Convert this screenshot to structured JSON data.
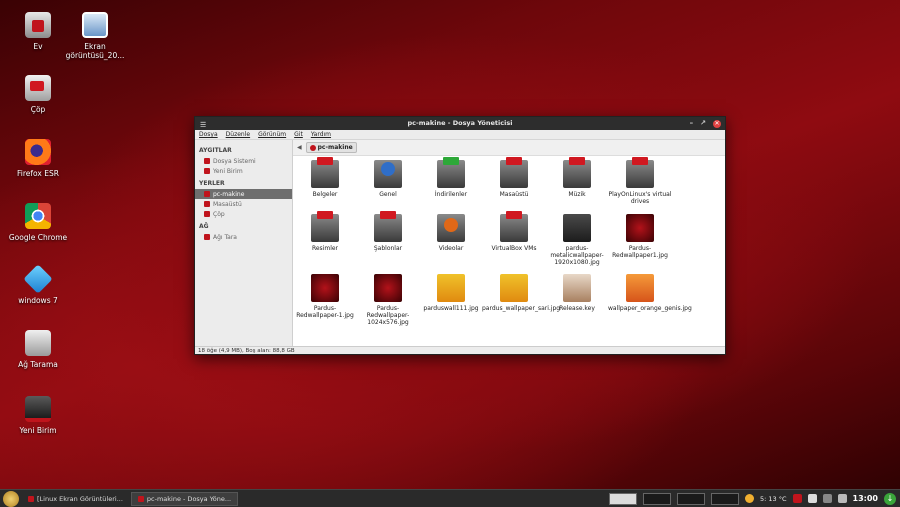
{
  "desktop": {
    "icons": [
      {
        "label": "Ev",
        "icon": "home-icon"
      },
      {
        "label": "Ekran görüntüsü_20...",
        "icon": "image-icon"
      },
      {
        "label": "Çöp",
        "icon": "trash-icon"
      },
      {
        "label": "Firefox ESR",
        "icon": "firefox-icon"
      },
      {
        "label": "Google Chrome",
        "icon": "chrome-icon"
      },
      {
        "label": "windows 7",
        "icon": "virtualbox-icon"
      },
      {
        "label": "Ağ Tarama",
        "icon": "scanner-icon"
      },
      {
        "label": "Yeni Birim",
        "icon": "drive-icon"
      }
    ]
  },
  "window": {
    "title": "pc-makine - Dosya Yöneticisi",
    "menu": [
      "Dosya",
      "Düzenle",
      "Görünüm",
      "Git",
      "Yardım"
    ],
    "sidebar": {
      "devices_header": "AYGITLAR",
      "devices": [
        "Dosya Sistemi",
        "Yeni Birim"
      ],
      "places_header": "YERLER",
      "places": [
        "pc-makine",
        "Masaüstü",
        "Çöp"
      ],
      "network_header": "AĞ",
      "network": [
        "Ağı Tara"
      ]
    },
    "path": "pc-makine",
    "files": [
      "Belgeler",
      "Genel",
      "İndirilenler",
      "Masaüstü",
      "Müzik",
      "PlayOnLinux's virtual drives",
      "Resimler",
      "Şablonlar",
      "Videolar",
      "VirtualBox VMs",
      "pardus-metalicwallpaper-1920x1080.jpg",
      "Pardus-Redwallpaper1.jpg",
      "Pardus-Redwallpaper-1.jpg",
      "Pardus-Redwallpaper-1024x576.jpg",
      "parduswall111.jpg",
      "pardus_wallpaper_sari.jpg",
      "Release.key",
      "wallpaper_orange_genis.jpg"
    ],
    "status": "18 öğe (4,9 MB), Boş alan: 88,8 GB"
  },
  "taskbar": {
    "tasks": [
      "[Linux Ekran Görüntüleri...",
      "pc-makine - Dosya Yöne..."
    ],
    "weather": "5: 13 °C",
    "clock": "13:00"
  },
  "colors": {
    "accent": "#c0141c",
    "taskbar": "#2a2a2a",
    "titlebar": "#2d2d2d"
  }
}
